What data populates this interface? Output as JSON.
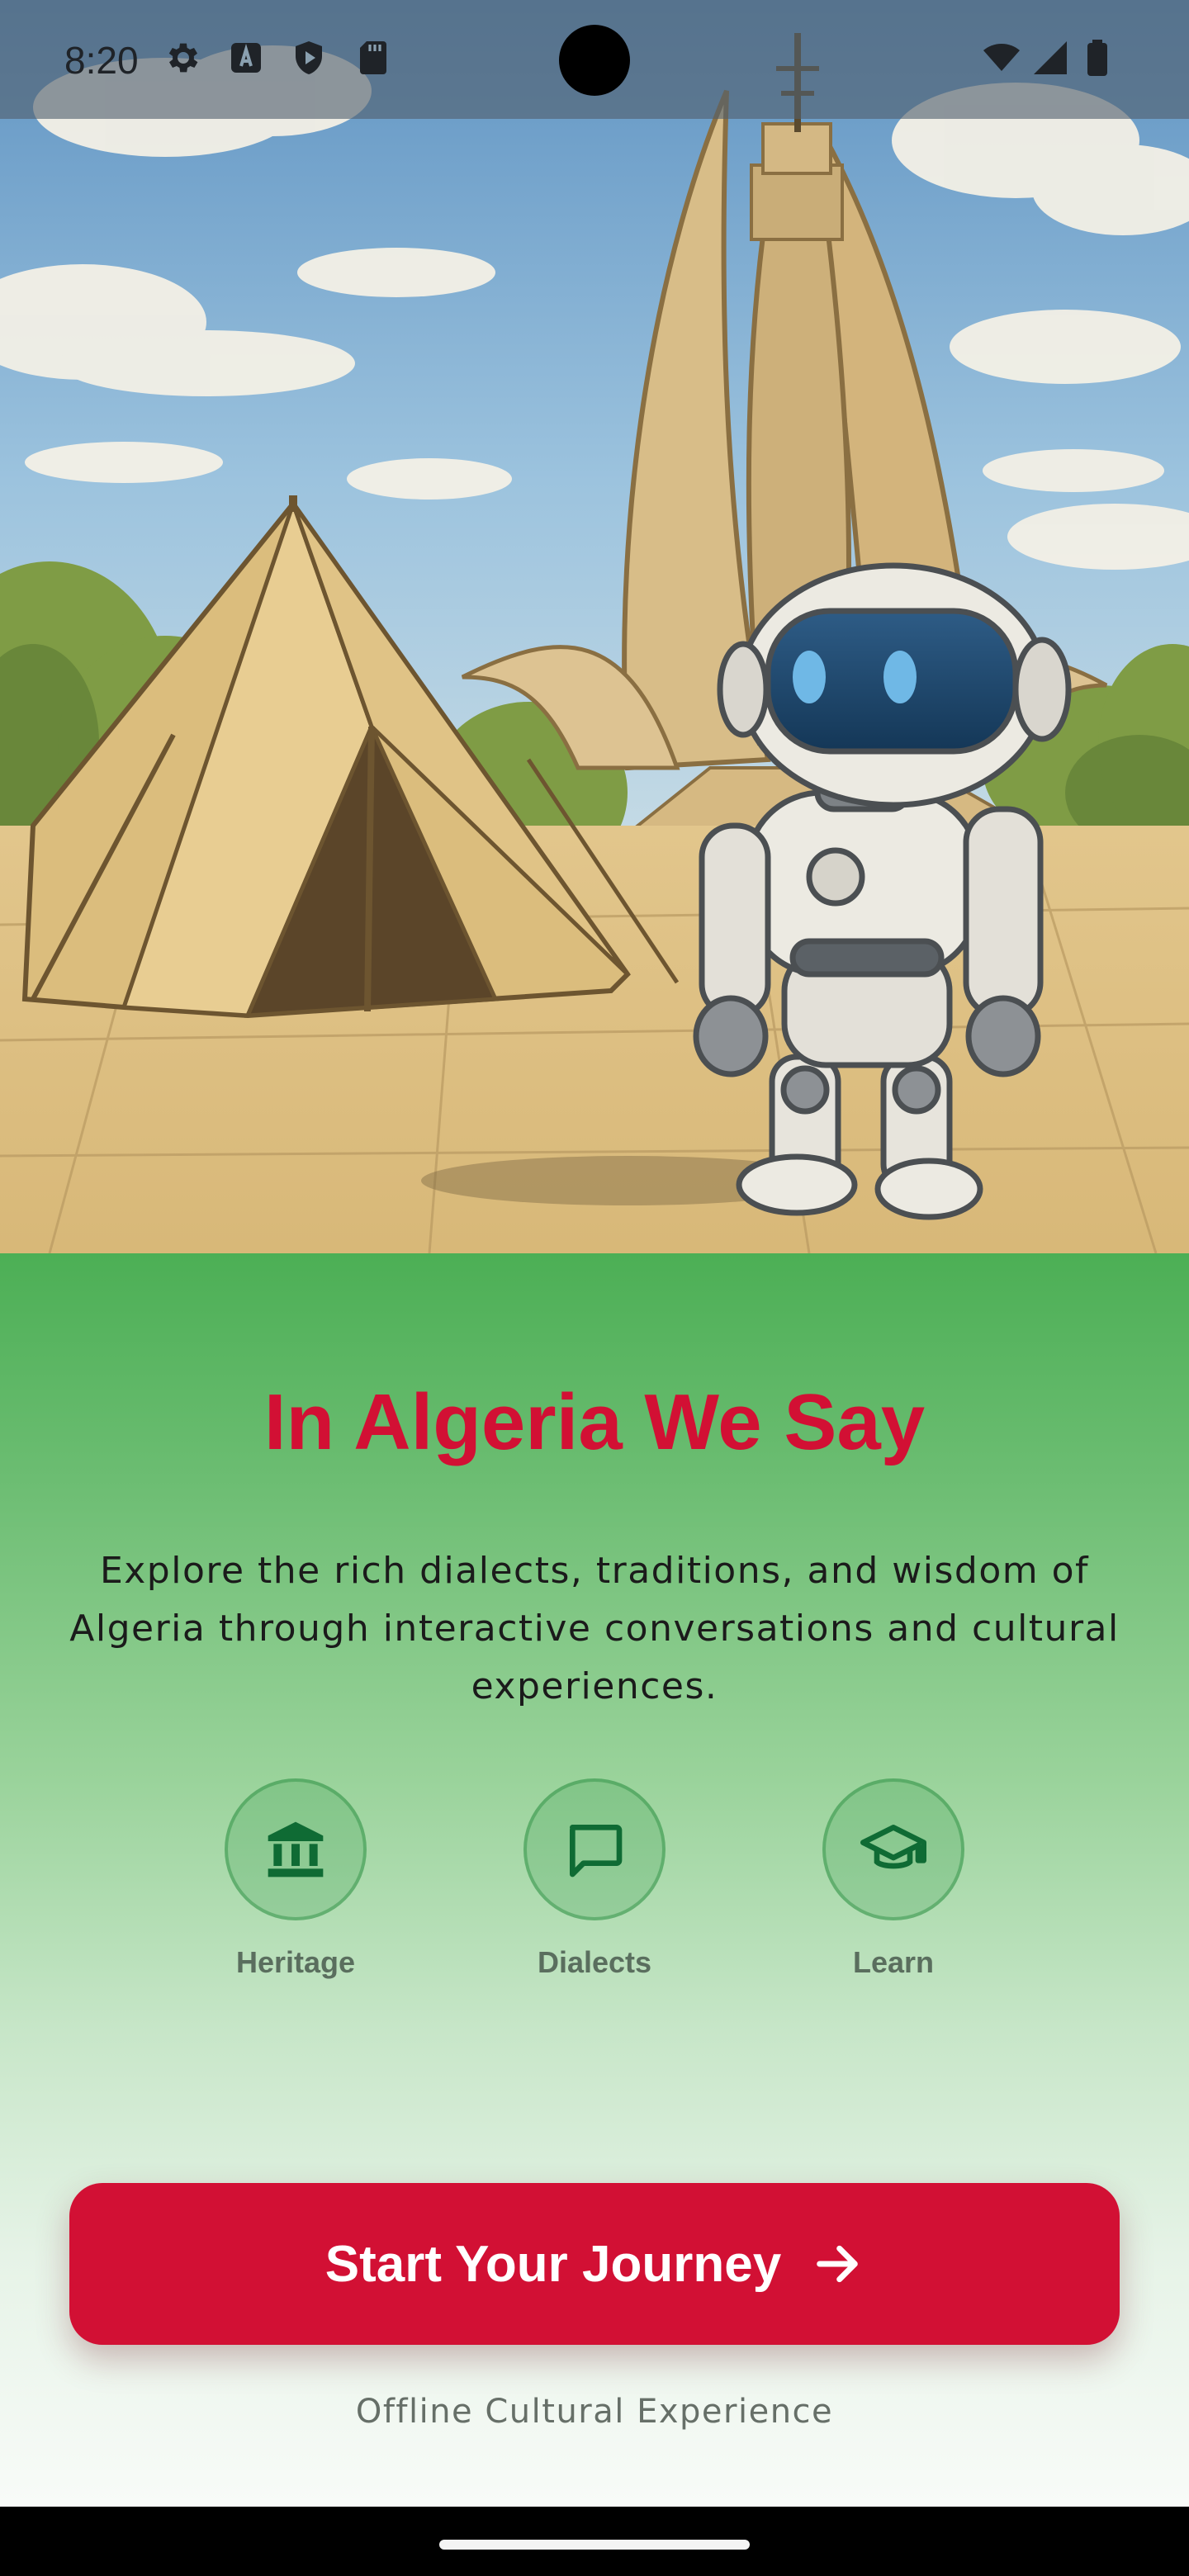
{
  "status_bar": {
    "time": "8:20",
    "left_icons": [
      "gear-icon",
      "font-app-icon",
      "shield-play-icon",
      "sd-card-icon"
    ],
    "right_icons": [
      "wifi-icon",
      "cell-signal-icon",
      "battery-icon"
    ]
  },
  "hero": {
    "scene": [
      "tent-icon",
      "monument-icon",
      "robot-mascot-icon"
    ]
  },
  "main": {
    "title": "In Algeria We Say",
    "description": "Explore the rich dialects, traditions, and wisdom of Algeria through interactive conversations and cultural experiences.",
    "features": [
      {
        "label": "Heritage",
        "icon": "museum-icon"
      },
      {
        "label": "Dialects",
        "icon": "chat-bubble-icon"
      },
      {
        "label": "Learn",
        "icon": "graduation-cap-icon"
      }
    ],
    "cta": {
      "label": "Start Your Journey",
      "icon": "arrow-right-icon"
    },
    "tagline": "Offline Cultural Experience"
  },
  "colors": {
    "accent_red": "#d21034",
    "green": "#4caf55",
    "icon_green": "#0f6b34"
  }
}
